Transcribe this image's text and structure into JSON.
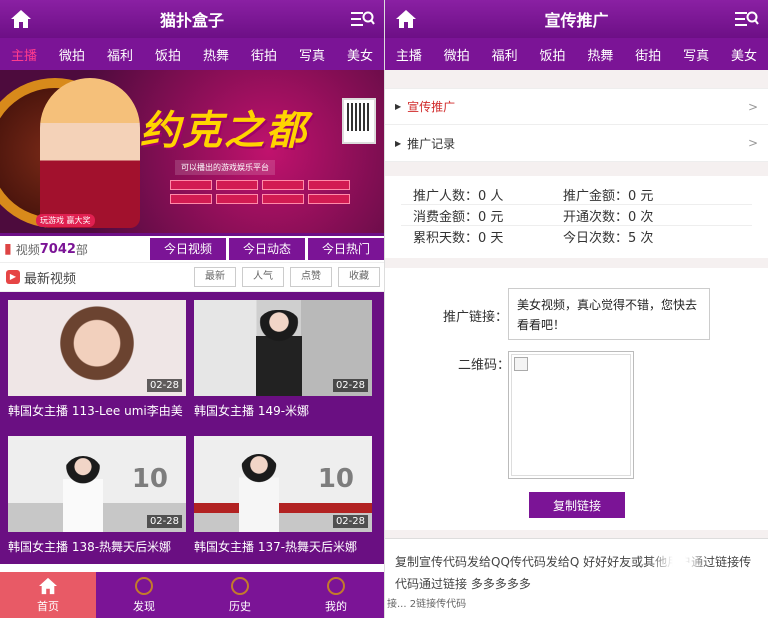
{
  "left": {
    "title": "猫扑盒子",
    "categories": [
      "主播",
      "微拍",
      "福利",
      "饭拍",
      "热舞",
      "街拍",
      "写真",
      "美女"
    ],
    "banner": {
      "title": "约克之都",
      "sub": "可以播出的游戏娱乐平台",
      "play": "玩游戏 赢大奖"
    },
    "stats": {
      "label": "视频",
      "count": "7042",
      "unit": "部"
    },
    "tabs": [
      "今日视频",
      "今日动态",
      "今日热门"
    ],
    "latest_label": "最新视频",
    "sorts": [
      "最新",
      "人气",
      "点赞",
      "收藏"
    ],
    "videos": [
      {
        "date": "02-28",
        "caption": "韩国女主播 113-Lee umi李由美"
      },
      {
        "date": "02-28",
        "caption": "韩国女主播 149-米娜"
      },
      {
        "date": "02-28",
        "caption": "韩国女主播 138-热舞天后米娜"
      },
      {
        "date": "02-28",
        "caption": "韩国女主播 137-热舞天后米娜"
      }
    ],
    "watermark": "10",
    "bottom_nav": [
      "首页",
      "发现",
      "历史",
      "我的"
    ]
  },
  "right": {
    "title": "宣传推广",
    "categories": [
      "主播",
      "微拍",
      "福利",
      "饭拍",
      "热舞",
      "街拍",
      "写真",
      "美女"
    ],
    "menu": [
      {
        "label": "宣传推广",
        "arrow": ">"
      },
      {
        "label": "推广记录",
        "arrow": ">"
      }
    ],
    "stats": [
      [
        "推广人数：0 人",
        "推广金额：0 元"
      ],
      [
        "消费金额：0 元",
        "开通次数：0 次"
      ],
      [
        "累积天数：0 天",
        "今日次数：5 次"
      ]
    ],
    "link_label": "推广链接：",
    "link_text": "美女视频，真心觉得不错，您快去看看吧！",
    "qr_label": "二维码：",
    "copy_button": "复制链接",
    "bottom_text": "复制宣传代码发给QQ传代码发给Q 好好好友或其他用户通过链接传代码通过链接 多多多多多",
    "bottom_foot": "接...  2链接传代码"
  },
  "colors": {
    "purple": "#7b1496",
    "active_pink": "#ff3b8d",
    "nav_active": "#e85a66"
  }
}
